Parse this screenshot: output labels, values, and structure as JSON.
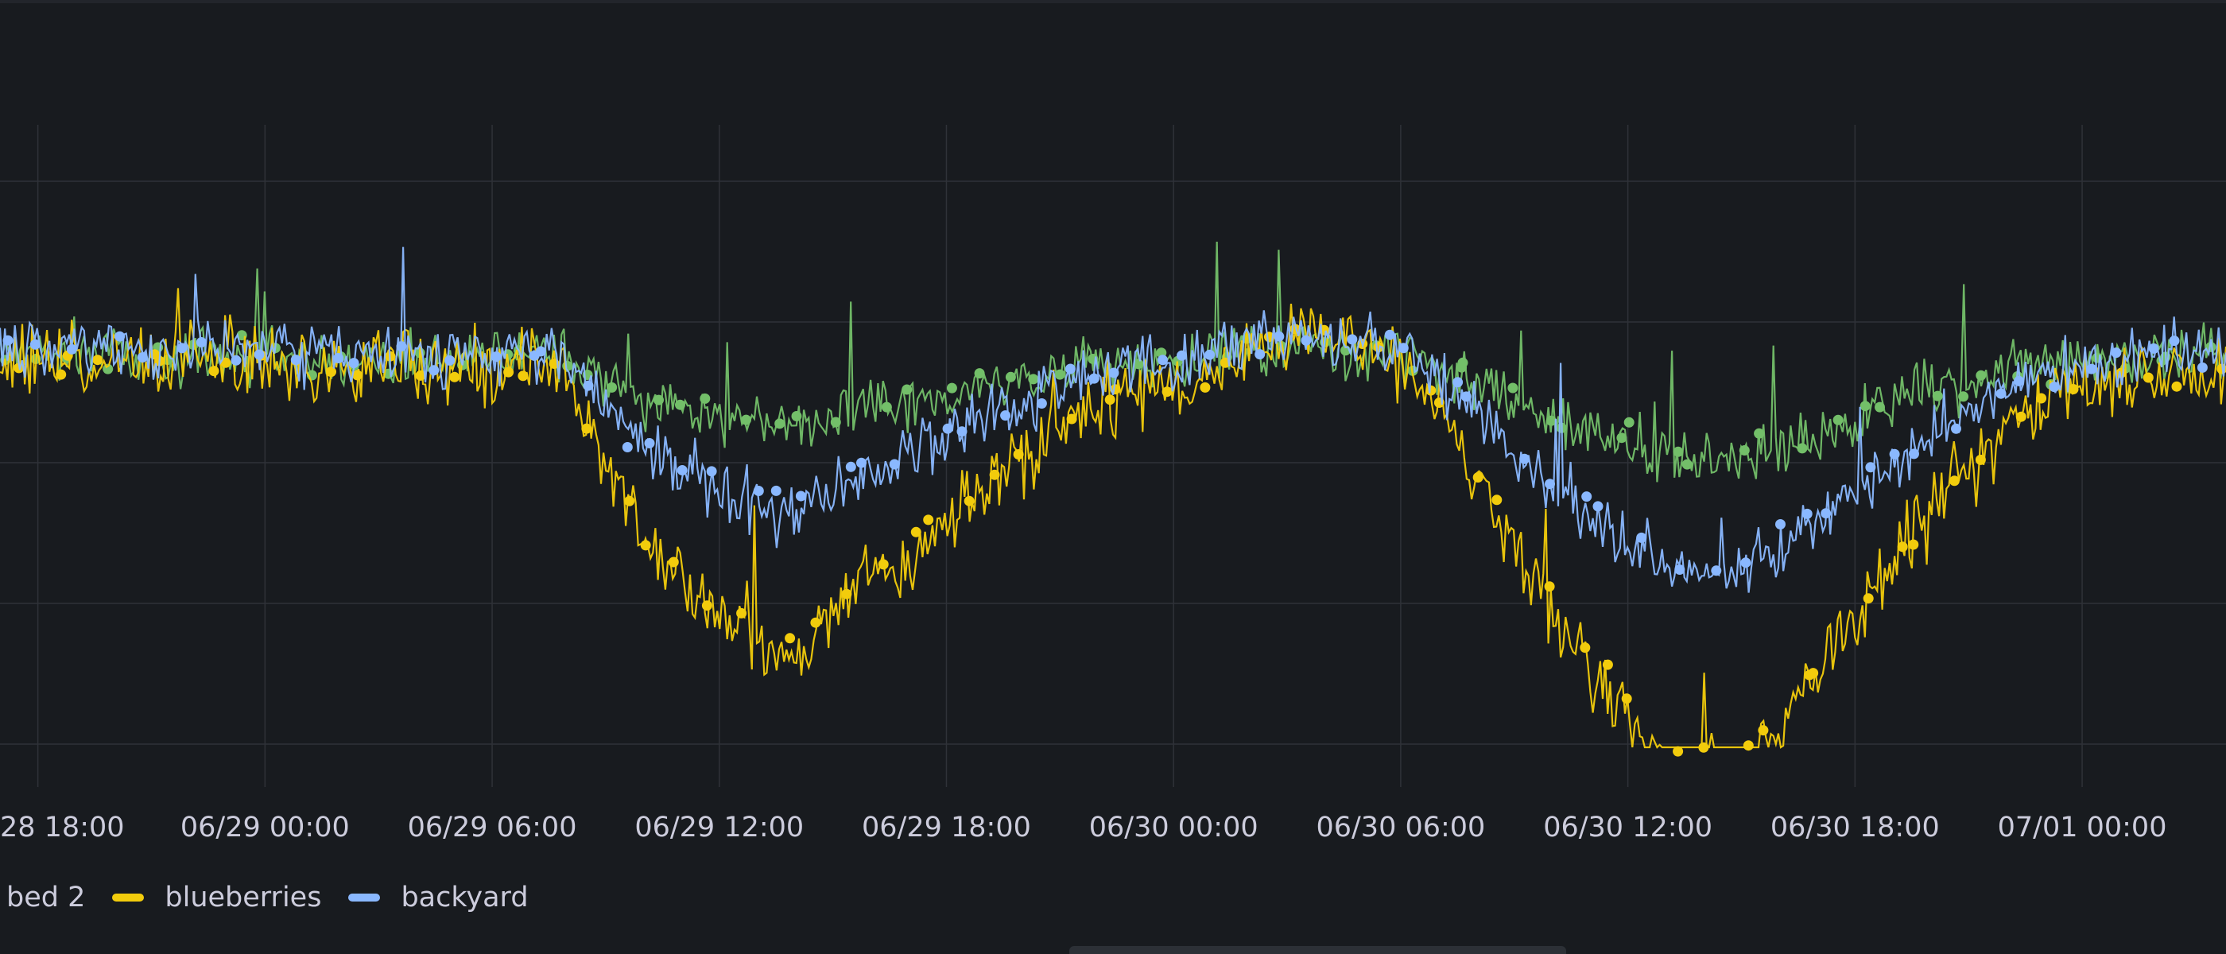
{
  "colors": {
    "background": "#181b1f",
    "grid": "#2f3238",
    "text": "#ccccdc",
    "series_green": "#73bf69",
    "series_yellow": "#f2cc0c",
    "series_blue": "#8ab8ff"
  },
  "chart_data": {
    "type": "line",
    "xlabel": "",
    "ylabel": "",
    "x_ticks": [
      "28 18:00",
      "06/29 00:00",
      "06/29 06:00",
      "06/29 12:00",
      "06/29 18:00",
      "06/30 00:00",
      "06/30 06:00",
      "06/30 12:00",
      "06/30 18:00",
      "07/01 00:00"
    ],
    "x_tick_hours": [
      -6,
      0,
      6,
      12,
      18,
      24,
      30,
      36,
      42,
      48
    ],
    "x_range_hours": [
      -7,
      51.8
    ],
    "y_grid_count": 5,
    "grid": true,
    "legend_position": "bottom-left",
    "y_shape_points": [
      [
        -7,
        0
      ],
      [
        -4,
        0
      ],
      [
        -1,
        0
      ],
      [
        1,
        0.05
      ],
      [
        4,
        0.1
      ],
      [
        7,
        0.05
      ],
      [
        8,
        0.1
      ],
      [
        9,
        0.8
      ],
      [
        10,
        1.3
      ],
      [
        11,
        1.6
      ],
      [
        12,
        1.8
      ],
      [
        13,
        2.0
      ],
      [
        14,
        2.1
      ],
      [
        15,
        1.8
      ],
      [
        16,
        1.5
      ],
      [
        17,
        1.4
      ],
      [
        18,
        1.2
      ],
      [
        19,
        0.9
      ],
      [
        20,
        0.7
      ],
      [
        21,
        0.5
      ],
      [
        22,
        0.3
      ],
      [
        23,
        0.25
      ],
      [
        24,
        0.2
      ],
      [
        26,
        -0.1
      ],
      [
        28,
        -0.2
      ],
      [
        30,
        0.0
      ],
      [
        31,
        0.3
      ],
      [
        32,
        0.8
      ],
      [
        33,
        1.3
      ],
      [
        34,
        1.8
      ],
      [
        35,
        2.2
      ],
      [
        36,
        2.5
      ],
      [
        37,
        2.9
      ],
      [
        38,
        3.0
      ],
      [
        39,
        2.9
      ],
      [
        40,
        2.6
      ],
      [
        41,
        2.2
      ],
      [
        42,
        1.9
      ],
      [
        43,
        1.5
      ],
      [
        44,
        1.1
      ],
      [
        45,
        0.8
      ],
      [
        46,
        0.5
      ],
      [
        47,
        0.3
      ],
      [
        48,
        0.2
      ],
      [
        50,
        0.1
      ],
      [
        52,
        0.1
      ]
    ],
    "series": [
      {
        "name": "bed 2",
        "color": "#73bf69"
      },
      {
        "name": "blueberries",
        "color": "#f2cc0c"
      },
      {
        "name": "backyard",
        "color": "#8ab8ff"
      }
    ]
  },
  "legend": {
    "items": [
      {
        "label": "bed 2"
      },
      {
        "label": "blueberries"
      },
      {
        "label": "backyard"
      }
    ]
  }
}
